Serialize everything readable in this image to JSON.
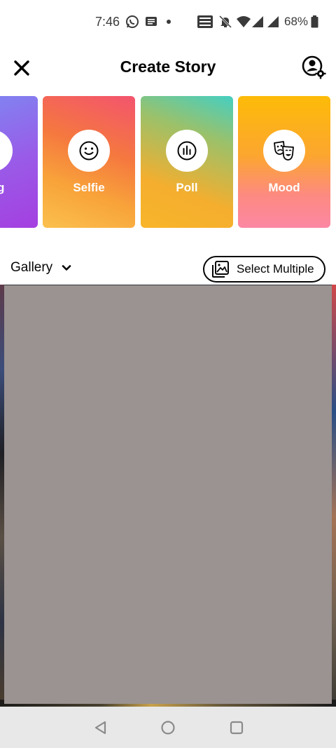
{
  "status_bar": {
    "time": "7:46",
    "battery_percent": "68%",
    "icons": [
      "whatsapp-icon",
      "message-icon",
      "dot-icon",
      "volte-icon",
      "mute-icon",
      "wifi-icon",
      "signal-icon",
      "signal-icon",
      "battery-icon"
    ]
  },
  "header": {
    "title": "Create Story",
    "close_icon": "close-icon",
    "settings_icon": "privacy-settings-icon"
  },
  "story_types": [
    {
      "label": "Boomerang",
      "visible_label": "rang",
      "icon": "boomerang-icon"
    },
    {
      "label": "Selfie",
      "icon": "smiley-face-icon"
    },
    {
      "label": "Poll",
      "icon": "poll-bars-icon"
    },
    {
      "label": "Mood",
      "icon": "theater-masks-icon"
    }
  ],
  "gallery": {
    "label": "Gallery",
    "select_multiple_label": "Select Multiple"
  },
  "nav_bar": {
    "back_icon": "back-triangle-icon",
    "home_icon": "home-circle-icon",
    "recents_icon": "recents-square-icon"
  },
  "colors": {
    "text": "#050505",
    "preview_overlay": "#9b9391",
    "nav_background": "#e8e8e8"
  }
}
